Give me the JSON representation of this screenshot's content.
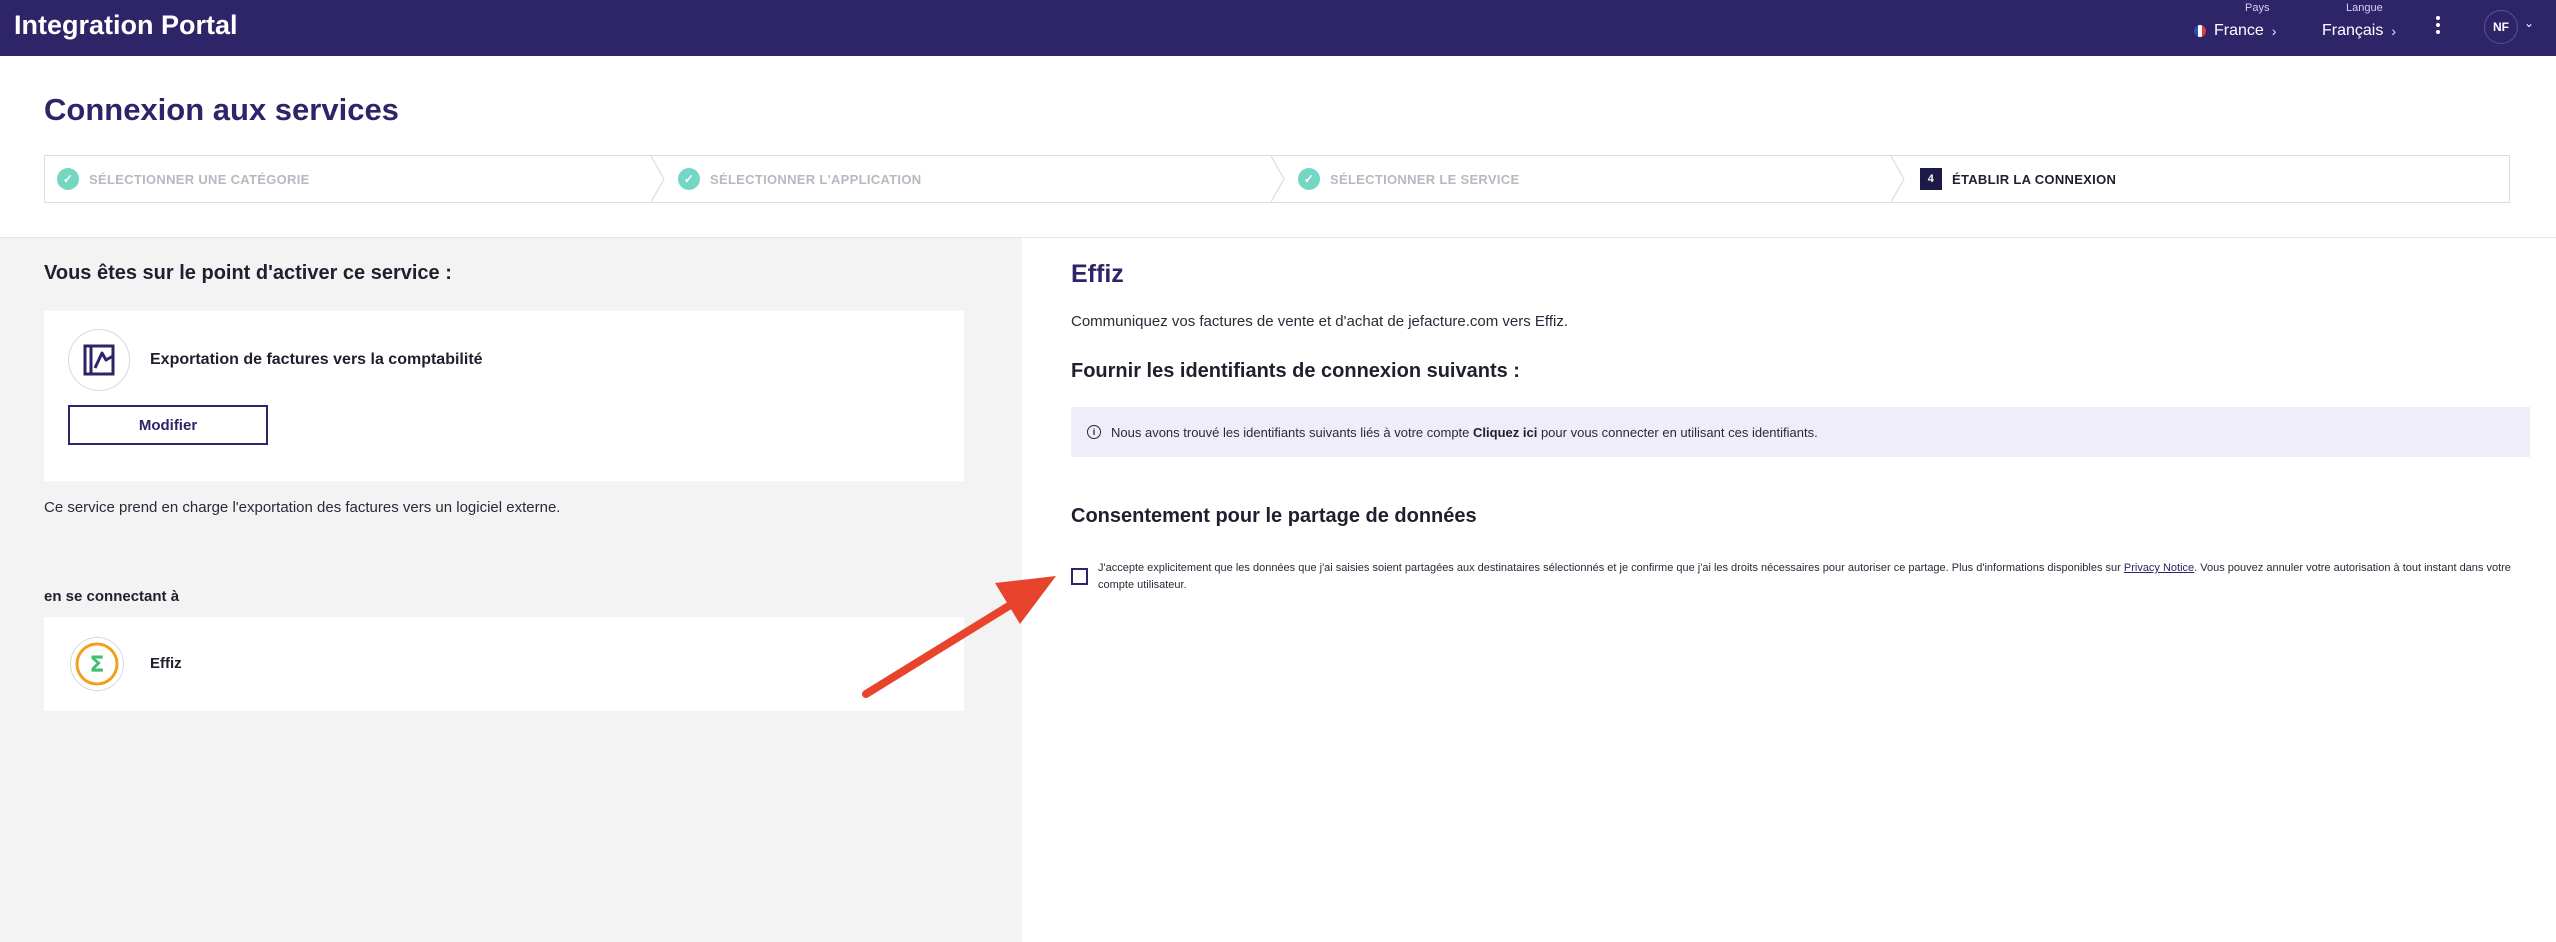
{
  "header": {
    "brand": "Integration Portal",
    "country": {
      "caption": "Pays",
      "value": "France"
    },
    "language": {
      "caption": "Langue",
      "value": "Français"
    },
    "avatar_initials": "NF",
    "background_color": "#2e2468"
  },
  "page": {
    "title": "Connexion aux services"
  },
  "stepper": {
    "steps": [
      {
        "label": "SÉLECTIONNER UNE CATÉGORIE",
        "state": "done"
      },
      {
        "label": "SÉLECTIONNER L'APPLICATION",
        "state": "done"
      },
      {
        "label": "SÉLECTIONNER LE SERVICE",
        "state": "done"
      },
      {
        "label": "ÉTABLIR LA CONNEXION",
        "state": "active",
        "number": "4"
      }
    ]
  },
  "left": {
    "heading": "Vous êtes sur le point d'activer ce service :",
    "service_name": "Exportation de factures vers la comptabilité",
    "modify_button": "Modifier",
    "description": "Ce service prend en charge l'exportation des factures vers un logiciel externe.",
    "connecting_label": "en se connectant à",
    "app_name": "Effiz"
  },
  "right": {
    "title": "Effiz",
    "description": "Communiquez vos factures de vente et d'achat de jefacture.com vers Effiz.",
    "credentials_heading": "Fournir les identifiants de connexion suivants :",
    "info": {
      "text_before": "Nous avons trouvé les identifiants suivants liés à votre compte",
      "link": "Cliquez ici",
      "text_after": "pour vous connecter en utilisant ces identifiants."
    },
    "consent_heading": "Consentement pour le partage de données",
    "consent": {
      "text_before": "J'accepte explicitement que les données que j'ai saisies soient partagées aux destinataires sélectionnés et je confirme que j'ai les droits nécessaires pour autoriser ce partage. Plus d'informations disponibles sur",
      "link": "Privacy Notice",
      "text_after": ". Vous pouvez annuler votre autorisation à tout instant dans votre compte utilisateur.",
      "checked": false
    }
  },
  "colors": {
    "accent": "#2e2468",
    "step_done": "#74d7c3",
    "annotation_arrow": "#e8432d"
  }
}
